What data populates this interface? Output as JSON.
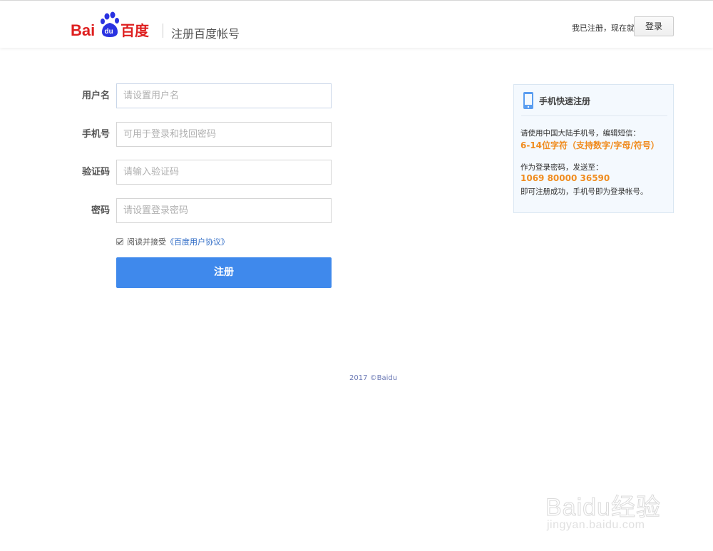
{
  "header": {
    "logo_text_left": "Bai",
    "logo_text_paw": "du",
    "logo_text_right": "百度",
    "title": "注册百度帐号",
    "already_registered": "我已注册，现在就",
    "login_label": "登录"
  },
  "form": {
    "fields": [
      {
        "label": "用户名",
        "placeholder": "请设置用户名"
      },
      {
        "label": "手机号",
        "placeholder": "可用于登录和找回密码"
      },
      {
        "label": "验证码",
        "placeholder": "请输入验证码"
      },
      {
        "label": "密码",
        "placeholder": "请设置登录密码"
      }
    ],
    "agree_text": "阅读并接受",
    "agree_link": "《百度用户协议》",
    "agree_checked": true,
    "submit_label": "注册"
  },
  "side": {
    "title": "手机快速注册",
    "line1": "请使用中国大陆手机号，编辑短信：",
    "highlight1": "6-14位字符（支持数字/字母/符号）",
    "line2": "作为登录密码，发送至：",
    "highlight2": "1069 80000 36590",
    "line3": "即可注册成功，手机号即为登录帐号。"
  },
  "footer": {
    "copyright": "2017 ©Baidu"
  },
  "watermark": {
    "text": "Baidu经验",
    "sub": "jingyan.baidu.com"
  },
  "colors": {
    "brand_red": "#de1f1f",
    "brand_blue": "#2932e1",
    "button_blue": "#3f89ec",
    "highlight_orange": "#f08c1f"
  }
}
